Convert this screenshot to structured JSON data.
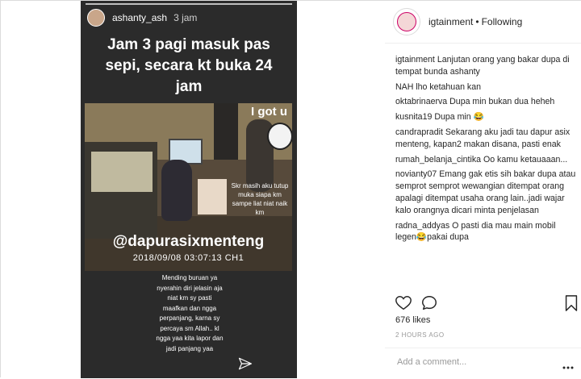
{
  "story": {
    "username": "ashanty_ash",
    "time": "3 jam",
    "headline": [
      "Jam 3 pagi masuk pas",
      "sepi, secara kt buka 24",
      "jam"
    ],
    "overlay_gotu": "I got u",
    "overlay_sticker": "Skr masih aku tutup muka siapa km sampe liat niat naik km",
    "overlay_handle": "@dapurasixmenteng",
    "overlay_timestamp": "2018/09/08 03:07:13 CH1",
    "caption_lines": [
      "Mending buruan ya",
      "nyerahin diri jelasin aja",
      "niat km sy pasti",
      "maafkan dan ngga",
      "perpanjang, karna sy",
      "percaya sm Allah.. kl",
      "ngga yaa kita lapor dan",
      "jadi panjang yaa"
    ]
  },
  "header": {
    "username": "igtainment",
    "separator": "•",
    "follow_status": "Following"
  },
  "comments": [
    {
      "user": "igtainment",
      "text": "Lanjutan orang yang bakar dupa di tempat bunda ashanty"
    },
    {
      "user": "",
      "text": "NAH lho ketahuan kan"
    },
    {
      "user": "oktabrinaerva",
      "text": "Dupa min bukan dua heheh"
    },
    {
      "user": "kusnita19",
      "text": "Dupa min 😂"
    },
    {
      "user": "candrapradit",
      "text": "Sekarang aku jadi tau dapur asix menteng, kapan2 makan disana, pasti enak"
    },
    {
      "user": "rumah_belanja_cintika",
      "text": "Oo kamu ketauaaan..."
    },
    {
      "user": "novianty07",
      "text": "Emang gak etis sih bakar dupa atau semprot semprot wewangian ditempat orang apalagi ditempat usaha orang lain..jadi wajar kalo orangnya dicari minta penjelasan"
    },
    {
      "user": "radna_addyas",
      "text": "O pasti dia mau main mobil legen😂pakai dupa"
    }
  ],
  "likes": "676 likes",
  "time_ago": "2 HOURS AGO",
  "add_comment_placeholder": "Add a comment...",
  "colors": {
    "story_bg": "#2b2b2b",
    "text": "#262626",
    "muted": "#999999"
  },
  "icons": [
    "heart-icon",
    "comment-icon",
    "bookmark-icon",
    "send-icon",
    "more-icon"
  ]
}
